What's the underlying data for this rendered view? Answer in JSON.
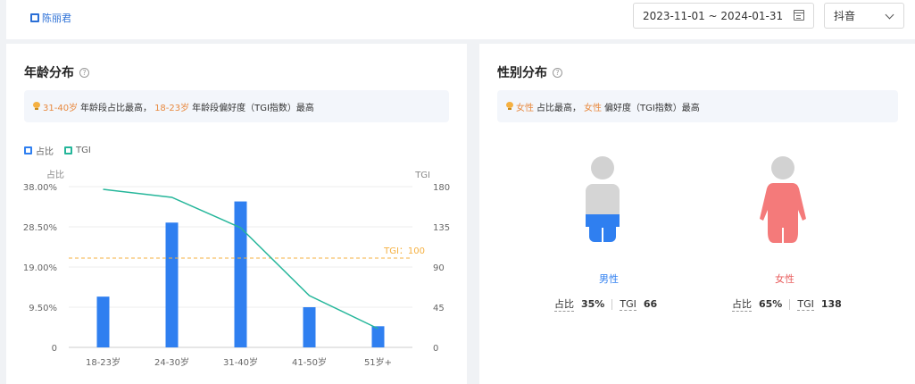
{
  "header": {
    "user_name": "陈丽君",
    "date_range": "2023-11-01 ~ 2024-01-31",
    "platform": "抖音"
  },
  "age_section": {
    "title": "年龄分布",
    "tip_highlight_1": "31-40岁",
    "tip_text_1": "年龄段占比最高，",
    "tip_highlight_2": "18-23岁",
    "tip_text_2": "年龄段偏好度（TGI指数）最高",
    "legend_share": "占比",
    "legend_tgi": "TGI"
  },
  "gender_section": {
    "title": "性别分布",
    "tip_highlight_1": "女性",
    "tip_text_1": "占比最高，",
    "tip_highlight_2": "女性",
    "tip_text_2": "偏好度（TGI指数）最高",
    "male": {
      "label": "男性",
      "share_label": "占比",
      "share": "35%",
      "tgi_label": "TGI",
      "tgi": "66"
    },
    "female": {
      "label": "女性",
      "share_label": "占比",
      "share": "65%",
      "tgi_label": "TGI",
      "tgi": "138"
    }
  },
  "colors": {
    "bar": "#2f7ff0",
    "line": "#25b69a",
    "ref": "#f5b041",
    "male_body": "#d5d5d5",
    "male_legs": "#2f7ff0",
    "female_body": "#f47a7a"
  },
  "chart_data": {
    "type": "bar",
    "categories": [
      "18-23岁",
      "24-30岁",
      "31-40岁",
      "41-50岁",
      "51岁+"
    ],
    "series": [
      {
        "name": "占比",
        "type": "bar",
        "axis": "left",
        "values": [
          12.0,
          29.5,
          34.5,
          9.5,
          5.0
        ]
      },
      {
        "name": "TGI",
        "type": "line",
        "axis": "right",
        "values": [
          177,
          168,
          134,
          58,
          21
        ]
      }
    ],
    "ylabel_left": "占比",
    "ylabel_right": "TGI",
    "yticks_left": [
      "0",
      "9.50%",
      "19.00%",
      "28.50%",
      "38.00%"
    ],
    "yticks_right": [
      "0",
      "45",
      "90",
      "135",
      "180"
    ],
    "ylim_left": [
      0,
      38
    ],
    "ylim_right": [
      0,
      180
    ],
    "reference_line": {
      "label": "TGI：100",
      "value": 100
    },
    "grid": true,
    "legend": "top-left"
  }
}
